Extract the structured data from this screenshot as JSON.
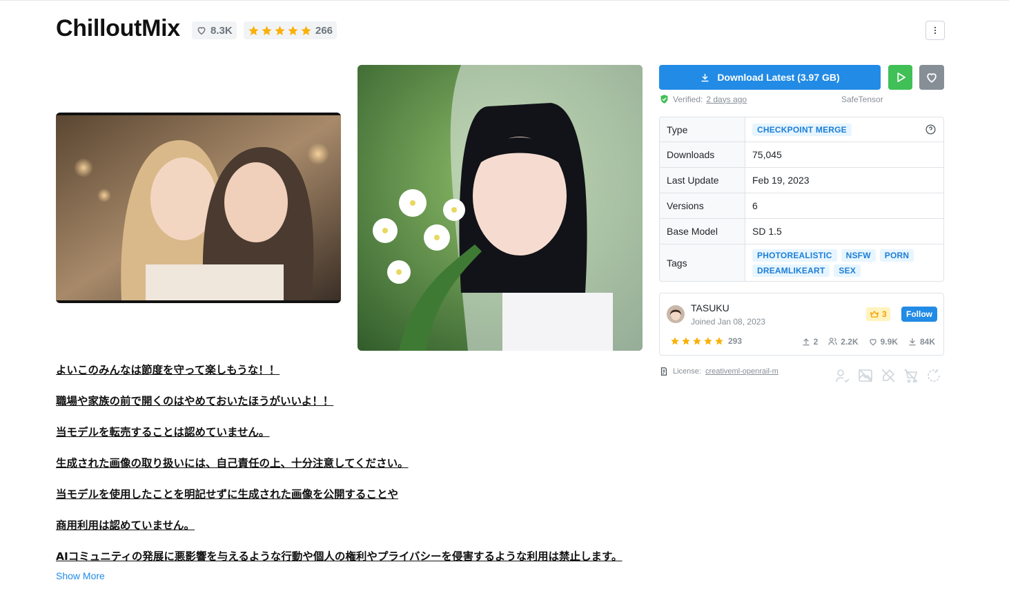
{
  "header": {
    "title": "ChilloutMix",
    "likes": "8.3K",
    "rating_count": "266"
  },
  "actions": {
    "download_label": "Download Latest (3.97 GB)",
    "verified_label": "Verified:",
    "verified_time": "2 days ago",
    "file_format": "SafeTensor"
  },
  "details": {
    "type_label": "Type",
    "type_value": "CHECKPOINT MERGE",
    "downloads_label": "Downloads",
    "downloads_value": "75,045",
    "last_update_label": "Last Update",
    "last_update_value": "Feb 19, 2023",
    "versions_label": "Versions",
    "versions_value": "6",
    "base_model_label": "Base Model",
    "base_model_value": "SD 1.5",
    "tags_label": "Tags",
    "tags": [
      "PHOTOREALISTIC",
      "NSFW",
      "PORN",
      "DREAMLIKEART",
      "SEX"
    ]
  },
  "creator": {
    "name": "TASUKU",
    "joined": "Joined Jan 08, 2023",
    "rank": "3",
    "follow_label": "Follow",
    "rating_count": "293",
    "uploads": "2",
    "followers": "2.2K",
    "likes": "9.9K",
    "downloads": "84K"
  },
  "license": {
    "label": "License:",
    "name": "creativeml-openrail-m"
  },
  "description": {
    "lines": [
      "よいこのみんなは節度を守って楽しもうな！！",
      "職場や家族の前で開くのはやめておいたほうがいいよ！！",
      "当モデルを転売することは認めていません。",
      "生成された画像の取り扱いには、自己責任の上、十分注意してください。",
      "当モデルを使用したことを明記せずに生成された画像を公開することや",
      "商用利用は認めていません。",
      "AIコミュニティの発展に悪影響を与えるような行動や個人の権利やプライバシーを侵害するような利用は禁止します。"
    ],
    "show_more": "Show More"
  },
  "colors": {
    "primary": "#228be6",
    "success": "#40c057",
    "star": "#fab005",
    "muted": "#868e96"
  }
}
